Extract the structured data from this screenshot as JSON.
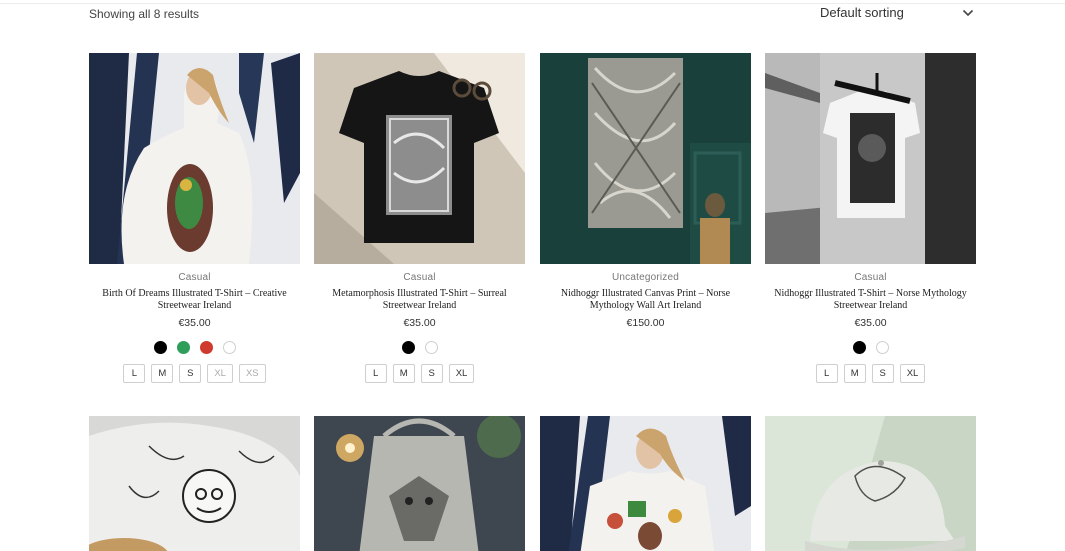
{
  "toolbar": {
    "result_count": "Showing all 8 results",
    "sorting_label": "Default sorting",
    "sorting_icon": "chevron-down-icon"
  },
  "products": [
    {
      "category": "Casual",
      "title": "Birth Of Dreams Illustrated T-Shirt – Creative Streetwear Ireland",
      "price": "€35.00",
      "swatches": [
        "#000000",
        "#2f9e5a",
        "#d03a2e",
        "#ffffff"
      ],
      "sizes": [
        "L",
        "M",
        "S",
        "XL",
        "XS"
      ]
    },
    {
      "category": "Casual",
      "title": "Metamorphosis Illustrated T-Shirt – Surreal Streetwear Ireland",
      "price": "€35.00",
      "swatches": [
        "#000000",
        "#ffffff"
      ],
      "sizes": [
        "L",
        "M",
        "S",
        "XL"
      ]
    },
    {
      "category": "Uncategorized",
      "title": "Nidhoggr Illustrated Canvas Print – Norse Mythology Wall Art Ireland",
      "price": "€150.00",
      "swatches": [],
      "sizes": []
    },
    {
      "category": "Casual",
      "title": "Nidhoggr Illustrated T-Shirt – Norse Mythology Streetwear Ireland",
      "price": "€35.00",
      "swatches": [
        "#000000",
        "#ffffff"
      ],
      "sizes": [
        "L",
        "M",
        "S",
        "XL"
      ]
    }
  ],
  "colors": {
    "background": "#ffffff",
    "text": "#333333",
    "muted": "#777777",
    "border": "#cfcfcf"
  }
}
